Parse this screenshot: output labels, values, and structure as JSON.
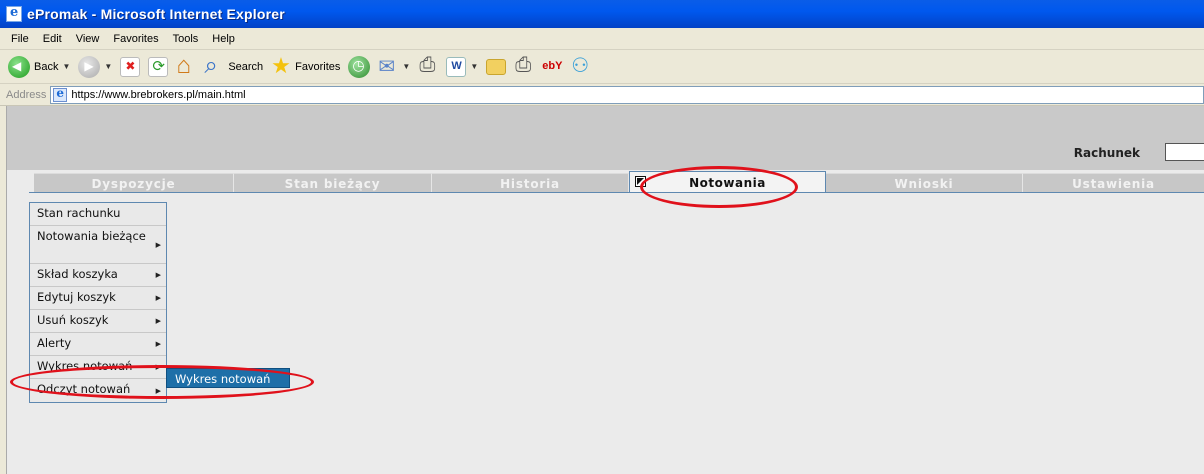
{
  "window": {
    "title": "ePromak - Microsoft Internet Explorer"
  },
  "menubar": {
    "items": [
      {
        "label": "File"
      },
      {
        "label": "Edit"
      },
      {
        "label": "View"
      },
      {
        "label": "Favorites"
      },
      {
        "label": "Tools"
      },
      {
        "label": "Help"
      }
    ]
  },
  "toolbar": {
    "back_label": "Back",
    "search_label": "Search",
    "favorites_label": "Favorites"
  },
  "address": {
    "label": "Address",
    "url": "https://www.brebrokers.pl/main.html"
  },
  "header": {
    "account_label": "Rachunek",
    "account_value": ""
  },
  "tabs": [
    {
      "label": "Dyspozycje",
      "active": false
    },
    {
      "label": "Stan bieżący",
      "active": false
    },
    {
      "label": "Historia",
      "active": false
    },
    {
      "label": "Notowania",
      "active": true
    },
    {
      "label": "Wnioski",
      "active": false
    },
    {
      "label": "Ustawienia",
      "active": false
    }
  ],
  "submenu": {
    "items": [
      {
        "label": "Stan rachunku",
        "has_children": false
      },
      {
        "label": "Notowania bieżące",
        "has_children": true
      },
      {
        "label": "Skład koszyka",
        "has_children": true
      },
      {
        "label": "Edytuj koszyk",
        "has_children": true
      },
      {
        "label": "Usuń koszyk",
        "has_children": true
      },
      {
        "label": "Alerty",
        "has_children": true
      },
      {
        "label": "Wykres notowań",
        "has_children": true
      },
      {
        "label": "Odczyt notowań",
        "has_children": true
      }
    ],
    "flyout_label": "Wykres notowań"
  },
  "colors": {
    "titlebar": "#0058ee",
    "tab_border": "#5e88b0",
    "flyout_bg": "#1e6fa8",
    "annotation": "#e0111b"
  }
}
